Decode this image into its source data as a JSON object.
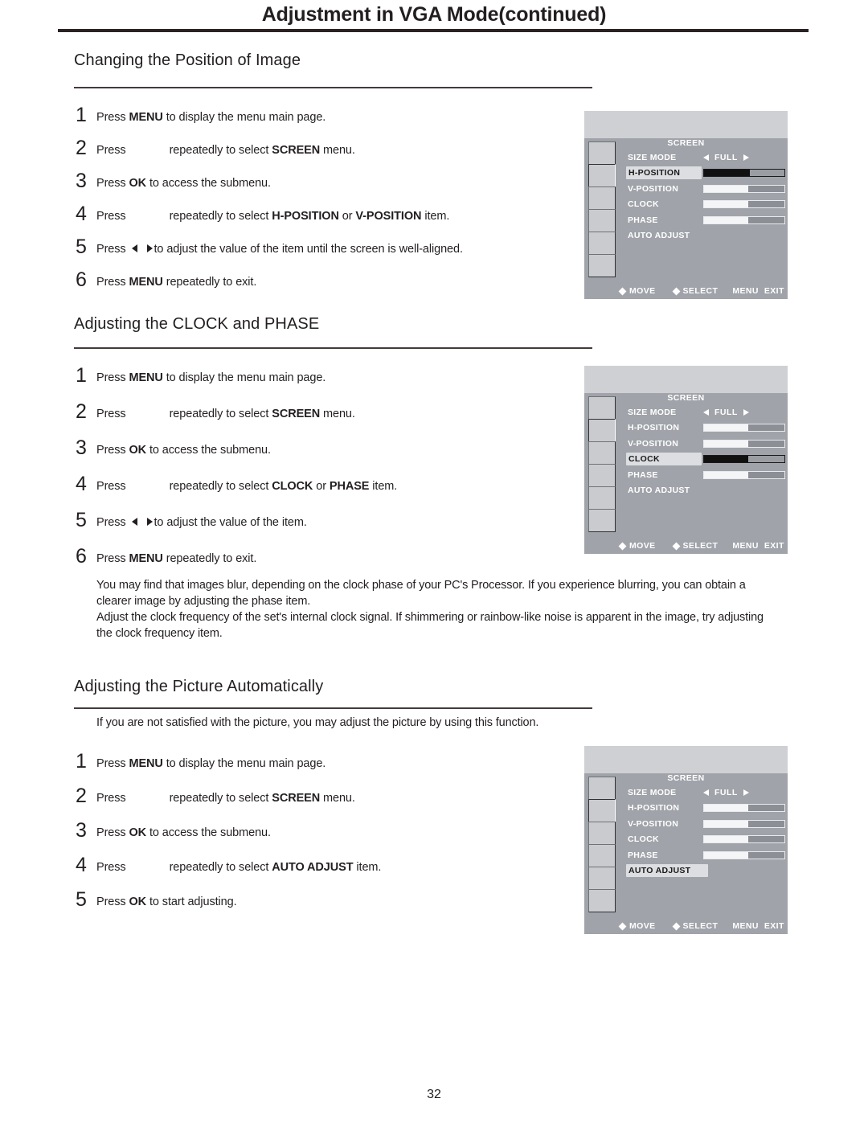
{
  "page": {
    "title": "Adjustment in VGA Mode(continued)",
    "number": "32"
  },
  "sections": [
    {
      "heading": "Changing the Position of Image",
      "steps": [
        {
          "num": "1",
          "pre": "Press ",
          "bold1": "MENU",
          "post": " to display the menu main page."
        },
        {
          "num": "2",
          "pre": "Press",
          "icon": true,
          "post": "repeatedly to select ",
          "bold1": "SCREEN",
          "tail": " menu."
        },
        {
          "num": "3",
          "pre": "Press ",
          "bold1": "OK",
          "post": " to access the submenu."
        },
        {
          "num": "4",
          "pre": "Press",
          "icon": true,
          "post": "repeatedly to select ",
          "bold1": "H-POSITION",
          "mid": " or ",
          "bold2": "V-POSITION",
          "tail": " item."
        },
        {
          "num": "5",
          "pre": "Press ",
          "arrows": true,
          "post": "to adjust the value of the item until the screen is well-aligned."
        },
        {
          "num": "6",
          "pre": "Press ",
          "bold1": "MENU",
          "post": " repeatedly to exit."
        }
      ]
    },
    {
      "heading": "Adjusting the CLOCK and PHASE",
      "steps": [
        {
          "num": "1",
          "pre": "Press ",
          "bold1": "MENU",
          "post": " to display the menu main page."
        },
        {
          "num": "2",
          "pre": "Press",
          "icon": true,
          "post": "repeatedly to select ",
          "bold1": "SCREEN",
          "tail": " menu."
        },
        {
          "num": "3",
          "pre": "Press ",
          "bold1": "OK",
          "post": " to access the submenu."
        },
        {
          "num": "4",
          "pre": "Press",
          "icon": true,
          "post": "repeatedly to select ",
          "bold1": "CLOCK",
          "mid": " or ",
          "bold2": "PHASE",
          "tail": " item."
        },
        {
          "num": "5",
          "pre": "Press ",
          "arrows": true,
          "post": "to adjust the value of the item."
        },
        {
          "num": "6",
          "pre": "Press ",
          "bold1": "MENU",
          "post": " repeatedly to exit."
        }
      ],
      "paragraph": [
        "You may find that images blur, depending on the clock phase of your PC's Processor. If you experience blurring, you can obtain a",
        "clearer image by adjusting the phase item.",
        "Adjust the clock frequency of the set's internal clock signal. If shimmering or rainbow-like noise is apparent in the image, try adjusting",
        "the clock frequency item."
      ]
    },
    {
      "heading": "Adjusting the Picture Automatically",
      "intro": "If you are not satisfied with the picture, you may adjust the picture by using this function.",
      "steps": [
        {
          "num": "1",
          "pre": "Press ",
          "bold1": "MENU",
          "post": " to display the menu main page."
        },
        {
          "num": "2",
          "pre": "Press",
          "icon": true,
          "post": "repeatedly to select ",
          "bold1": "SCREEN",
          "tail": " menu."
        },
        {
          "num": "3",
          "pre": "Press ",
          "bold1": "OK",
          "post": " to access the submenu."
        },
        {
          "num": "4",
          "pre": "Press",
          "icon": true,
          "post": "repeatedly to select ",
          "bold1": "AUTO ADJUST",
          "tail": " item."
        },
        {
          "num": "5",
          "pre": "Press ",
          "bold1": "OK",
          "post": " to start adjusting."
        }
      ]
    }
  ],
  "osd_menus": [
    {
      "title": "SCREEN",
      "sidebar_active_index": 1,
      "rows": [
        {
          "label": "SIZE MODE",
          "type": "option",
          "value": "FULL",
          "selected": false
        },
        {
          "label": "H-POSITION",
          "type": "bar",
          "fill": 57,
          "selected": true
        },
        {
          "label": "V-POSITION",
          "type": "bar",
          "fill": 55,
          "selected": false
        },
        {
          "label": "CLOCK",
          "type": "bar",
          "fill": 55,
          "selected": false
        },
        {
          "label": "PHASE",
          "type": "bar",
          "fill": 55,
          "selected": false
        },
        {
          "label": "AUTO ADJUST",
          "type": "none",
          "selected": false
        }
      ],
      "footer": {
        "move": "MOVE",
        "select": "SELECT",
        "menu": "MENU",
        "exit": "EXIT"
      }
    },
    {
      "title": "SCREEN",
      "sidebar_active_index": 1,
      "rows": [
        {
          "label": "SIZE MODE",
          "type": "option",
          "value": "FULL",
          "selected": false
        },
        {
          "label": "H-POSITION",
          "type": "bar",
          "fill": 55,
          "selected": false
        },
        {
          "label": "V-POSITION",
          "type": "bar",
          "fill": 55,
          "selected": false
        },
        {
          "label": "CLOCK",
          "type": "bar",
          "fill": 55,
          "selected": true
        },
        {
          "label": "PHASE",
          "type": "bar",
          "fill": 55,
          "selected": false
        },
        {
          "label": "AUTO ADJUST",
          "type": "none",
          "selected": false
        }
      ],
      "footer": {
        "move": "MOVE",
        "select": "SELECT",
        "menu": "MENU",
        "exit": "EXIT"
      }
    },
    {
      "title": "SCREEN",
      "sidebar_active_index": 1,
      "rows": [
        {
          "label": "SIZE MODE",
          "type": "option",
          "value": "FULL",
          "selected": false
        },
        {
          "label": "H-POSITION",
          "type": "bar",
          "fill": 55,
          "selected": false
        },
        {
          "label": "V-POSITION",
          "type": "bar",
          "fill": 55,
          "selected": false
        },
        {
          "label": "CLOCK",
          "type": "bar",
          "fill": 55,
          "selected": false
        },
        {
          "label": "PHASE",
          "type": "bar",
          "fill": 55,
          "selected": false
        },
        {
          "label": "AUTO ADJUST",
          "type": "none",
          "selected": true
        }
      ],
      "footer": {
        "move": "MOVE",
        "select": "SELECT",
        "menu": "MENU",
        "exit": "EXIT"
      }
    }
  ]
}
